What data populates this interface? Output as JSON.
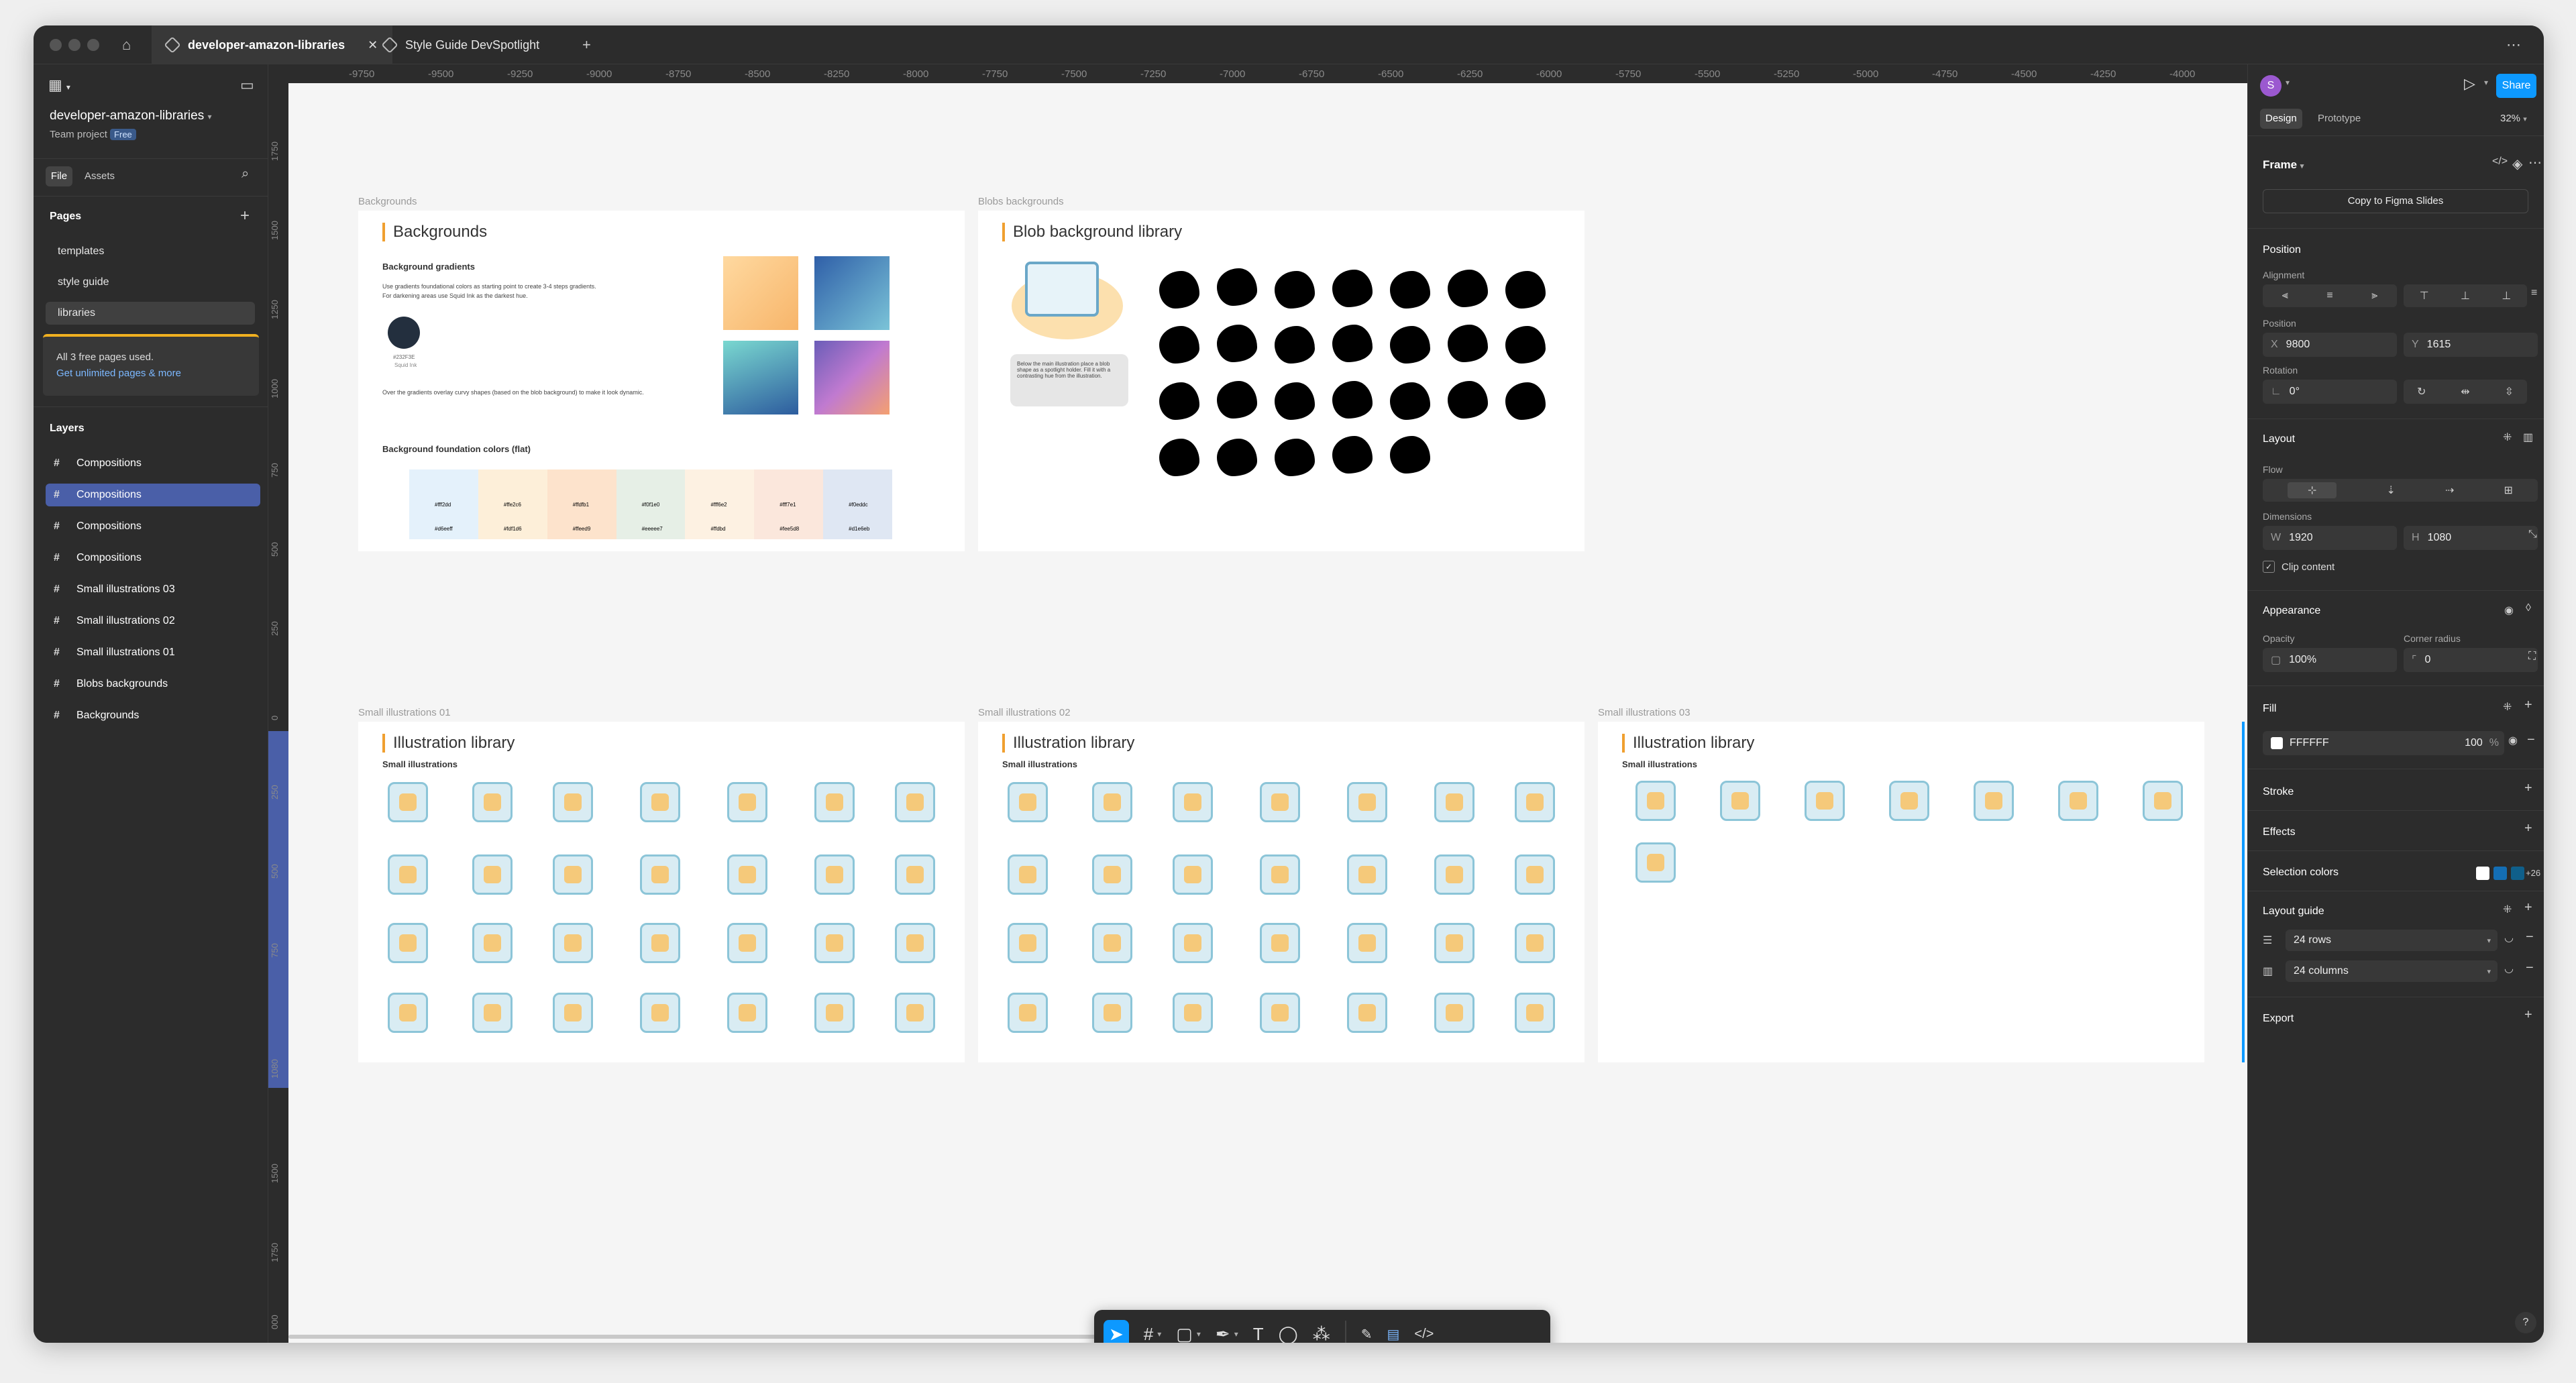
{
  "tabs": [
    {
      "label": "developer-amazon-libraries"
    },
    {
      "label": "Style Guide DevSpotlight"
    }
  ],
  "project": {
    "name": "developer-amazon-libraries",
    "team": "Team project",
    "plan": "Free"
  },
  "left_tabs": {
    "file": "File",
    "assets": "Assets"
  },
  "pages": {
    "heading": "Pages",
    "items": [
      "templates",
      "style guide",
      "libraries"
    ]
  },
  "upgrade": {
    "text": "All 3 free pages used.",
    "link": "Get unlimited pages & more"
  },
  "layers": {
    "heading": "Layers",
    "items": [
      "Compositions",
      "Compositions",
      "Compositions",
      "Compositions",
      "Small illustrations 03",
      "Small illustrations 02",
      "Small illustrations 01",
      "Blobs backgrounds",
      "Backgrounds"
    ]
  },
  "ruler": {
    "top": [
      "-9750",
      "-9500",
      "-9250",
      "-9000",
      "-8750",
      "-8500",
      "-8250",
      "-8000",
      "-7750",
      "-7500",
      "-7250",
      "-7000",
      "-6750",
      "-6500",
      "-6250",
      "-6000",
      "-5750",
      "-5500",
      "-5250",
      "-5000",
      "-4750",
      "-4500",
      "-4250",
      "-4000"
    ],
    "left": [
      "1750",
      "1500",
      "1250",
      "1000",
      "750",
      "500",
      "250",
      "0",
      "250",
      "500",
      "750",
      "1080",
      "1500",
      "1750",
      "000"
    ]
  },
  "frames": {
    "backgrounds": {
      "label": "Backgrounds",
      "title": "Backgrounds",
      "section1": "Background gradients",
      "desc1": "Use gradients foundational colors as starting point to create 3-4 steps gradients.",
      "desc2": "For darkening areas use Squid Ink as the darkest hue.",
      "swatch_name": "#232F3E",
      "swatch_sub": "Squid Ink",
      "desc3": "Over the gradients overlay curvy shapes (based on the blob background) to make it look dynamic.",
      "section2": "Background foundation colors (flat)",
      "flat_top": [
        "#fff2dd",
        "#ffe2c6",
        "#ffdfb1",
        "#f0f1e0",
        "#fff6e2",
        "#fff7e1",
        "#f0eddc"
      ],
      "flat_bottom": [
        "#d6eeff",
        "#fdf1d6",
        "#ffeed9",
        "#eeeee7",
        "#ffdbd",
        "#fee5d8",
        "#d1e6eb"
      ]
    },
    "blobs": {
      "label": "Blobs backgrounds",
      "title": "Blob background library",
      "note": "Below the main illustration place a blob shape as a spotlight holder. Fill it with a contrasting hue from the illustration."
    },
    "small1": {
      "label": "Small illustrations 01",
      "title": "Illustration library",
      "sub": "Small illustrations"
    },
    "small2": {
      "label": "Small illustrations 02",
      "title": "Illustration library",
      "sub": "Small illustrations"
    },
    "small3": {
      "label": "Small illustrations 03",
      "title": "Illustration library",
      "sub": "Small illustrations"
    }
  },
  "right": {
    "avatar": "S",
    "share": "Share",
    "tab_design": "Design",
    "tab_prototype": "Prototype",
    "zoom": "32%",
    "frame_label": "Frame",
    "copy_btn": "Copy to Figma Slides",
    "position": "Position",
    "alignment": "Alignment",
    "position_sub": "Position",
    "x_label": "X",
    "x_value": "9800",
    "y_label": "Y",
    "y_value": "1615",
    "rotation": "Rotation",
    "rotation_value": "0°",
    "layout": "Layout",
    "flow": "Flow",
    "dimensions": "Dimensions",
    "w_label": "W",
    "w_value": "1920",
    "h_label": "H",
    "h_value": "1080",
    "clip": "Clip content",
    "appearance": "Appearance",
    "opacity": "Opacity",
    "opacity_value": "100%",
    "corner": "Corner radius",
    "corner_value": "0",
    "fill": "Fill",
    "fill_hex": "FFFFFF",
    "fill_opacity": "100",
    "fill_pct": "%",
    "stroke": "Stroke",
    "effects": "Effects",
    "selection_colors": "Selection colors",
    "selection_more": "+26",
    "layout_guide": "Layout guide",
    "rows": "24 rows",
    "columns": "24 columns",
    "export": "Export",
    "help": "?"
  },
  "colors": {
    "accent": "#0d99ff",
    "layer_selected": "#4a5fa8",
    "frame_accent": "#f0a030"
  }
}
